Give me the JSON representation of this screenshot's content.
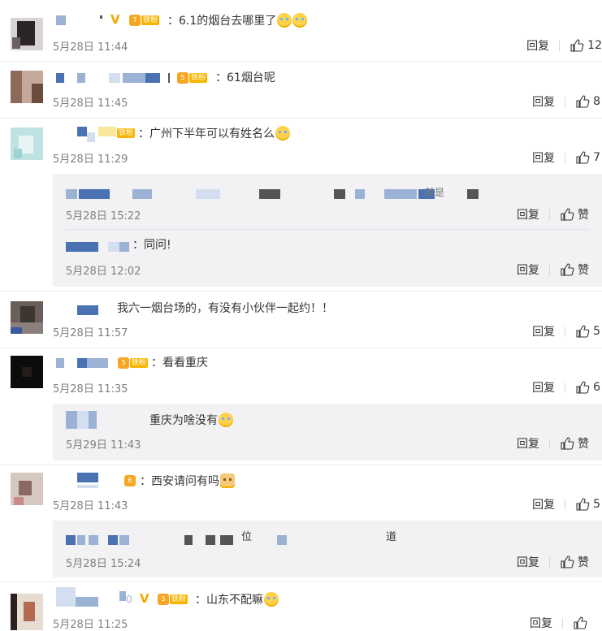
{
  "colors": {
    "name_blue": "#4a72b2",
    "fan_badge": "#f7b500",
    "like": "#333333",
    "time": "#808080"
  },
  "comments": [
    {
      "text": "：6.1的烟台去哪里了",
      "time": "5月28日 11:44",
      "reply": "回复",
      "likes": "12",
      "fan": "铁粉",
      "crown": "7"
    },
    {
      "text": "：61烟台呢",
      "time": "5月28日 11:45",
      "reply": "回复",
      "likes": "8",
      "fan": "铁粉",
      "crown": "5"
    },
    {
      "text": "：广州下半年可以有姓名么",
      "time": "5月28日 11:29",
      "reply": "回复",
      "likes": "7",
      "fan": "铁粉"
    },
    {
      "text": "我六一烟台场的，有没有小伙伴一起约！！",
      "time": "5月28日 11:57",
      "reply": "回复",
      "likes": "5"
    },
    {
      "text": "：看看重庆",
      "time": "5月28日 11:35",
      "reply": "回复",
      "likes": "6",
      "fan": "铁粉",
      "crown": "5"
    },
    {
      "text": "：西安请问有吗",
      "time": "5月28日 11:43",
      "reply": "回复",
      "likes": "5",
      "crown": "6"
    },
    {
      "text": "：山东不配嘛",
      "time": "5月28日 11:25",
      "reply": "回复",
      "likes": "",
      "fan": "铁粉",
      "crown": "5"
    }
  ],
  "replies": [
    {
      "text": "就是",
      "time": "5月28日 15:22",
      "reply": "回复",
      "likes": "赞"
    },
    {
      "text": "：同问!",
      "time": "5月28日 12:02",
      "reply": "回复",
      "likes": "赞"
    },
    {
      "text": "重庆为啥没有",
      "time": "5月29日 11:43",
      "reply": "回复",
      "likes": "赞"
    },
    {
      "text": "位",
      "text2": "道",
      "time": "5月28日 15:24",
      "reply": "回复",
      "likes": "赞"
    }
  ]
}
